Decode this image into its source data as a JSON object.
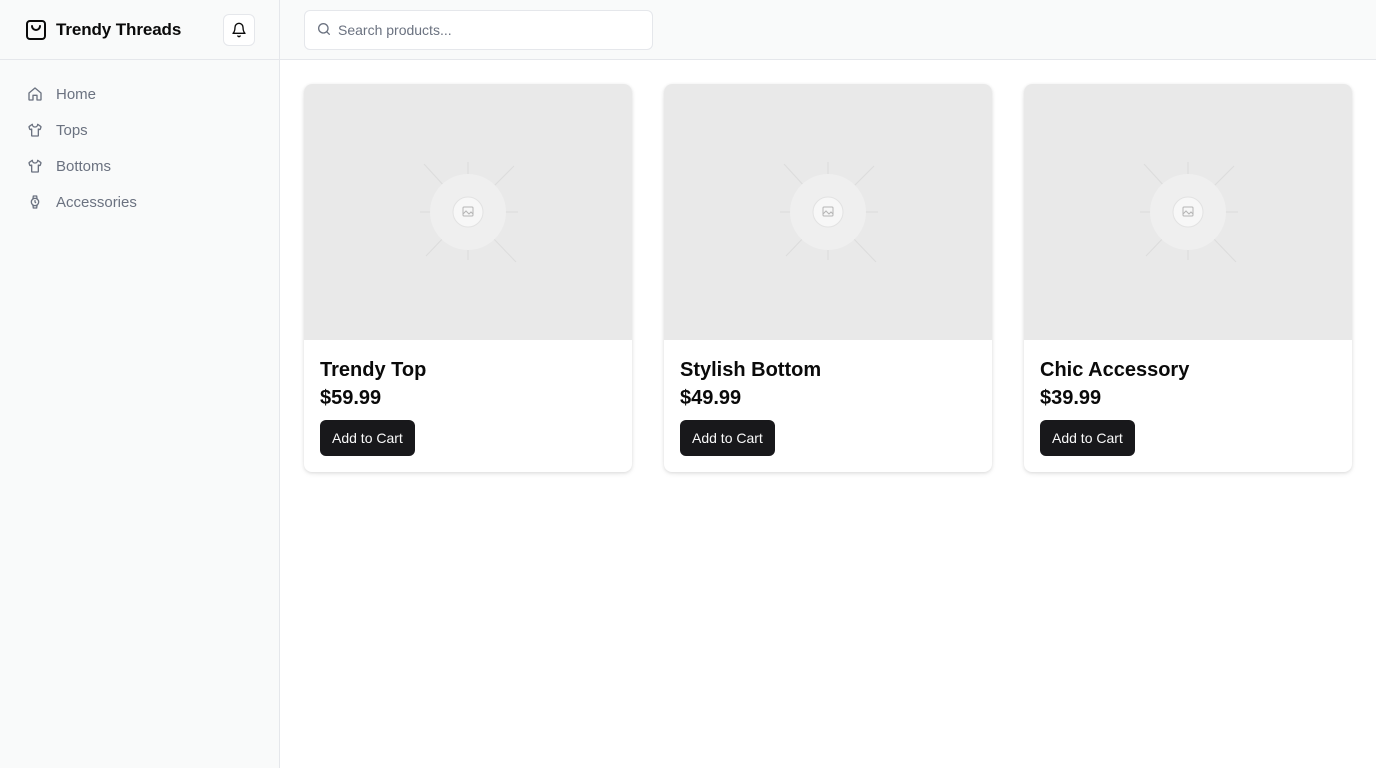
{
  "brand": {
    "name": "Trendy Threads",
    "icon": "shopping-bag-icon"
  },
  "header": {
    "notification_icon": "bell-icon"
  },
  "search": {
    "placeholder": "Search products...",
    "value": "",
    "icon": "search-icon"
  },
  "sidebar": {
    "items": [
      {
        "label": "Home",
        "icon": "home-icon"
      },
      {
        "label": "Tops",
        "icon": "shirt-icon"
      },
      {
        "label": "Bottoms",
        "icon": "shirt-icon"
      },
      {
        "label": "Accessories",
        "icon": "watch-icon"
      }
    ]
  },
  "products": [
    {
      "name": "Trendy Top",
      "price": "$59.99",
      "button": "Add to Cart",
      "image": "image-placeholder-icon"
    },
    {
      "name": "Stylish Bottom",
      "price": "$49.99",
      "button": "Add to Cart",
      "image": "image-placeholder-icon"
    },
    {
      "name": "Chic Accessory",
      "price": "$39.99",
      "button": "Add to Cart",
      "image": "image-placeholder-icon"
    }
  ],
  "colors": {
    "sidebar_bg": "#f9fafa",
    "border": "#e5e7eb",
    "muted_text": "#6b7280",
    "primary_button": "#18181b",
    "image_placeholder": "#e9e9e9"
  }
}
